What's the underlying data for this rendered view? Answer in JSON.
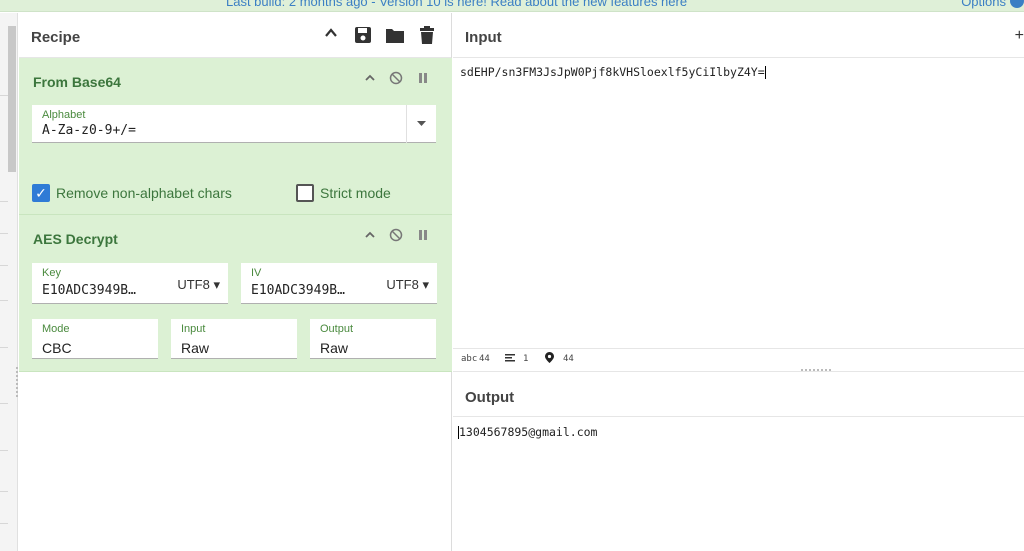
{
  "banner": {
    "text": "Last build: 2 months ago - Version 10 is here! Read about the new features here",
    "options_label": "Options"
  },
  "recipe": {
    "title": "Recipe",
    "header_icons": [
      "chevron-up-icon",
      "save-icon",
      "folder-icon",
      "trash-icon"
    ],
    "operations": [
      {
        "title": "From Base64",
        "alphabet_label": "Alphabet",
        "alphabet_value": "A-Za-z0-9+/=",
        "remove_non_alphabet_label": "Remove non-alphabet chars",
        "remove_non_alphabet_checked": true,
        "strict_mode_label": "Strict mode",
        "strict_mode_checked": false
      },
      {
        "title": "AES Decrypt",
        "key_label": "Key",
        "key_value": "E10ADC3949B…",
        "key_encoding": "UTF8",
        "iv_label": "IV",
        "iv_value": "E10ADC3949B…",
        "iv_encoding": "UTF8",
        "mode_label": "Mode",
        "mode_value": "CBC",
        "input_label": "Input",
        "input_value": "Raw",
        "output_label": "Output",
        "output_value": "Raw"
      }
    ]
  },
  "input": {
    "title": "Input",
    "text": "sdEHP/sn3FM3JsJpW0Pjf8kVHSloexlf5yCiIlbyZ4Y=",
    "status": {
      "abc_label": "abc",
      "length": "44",
      "lines": "1",
      "position": "44"
    }
  },
  "output": {
    "title": "Output",
    "text": "1304567895@gmail.com"
  },
  "colors": {
    "op_background": "#dcf1d4",
    "op_title": "#3c763d",
    "checkbox_accent": "#2f7bd6",
    "banner_bg": "#dff0d8",
    "link": "#3b7fc4"
  }
}
